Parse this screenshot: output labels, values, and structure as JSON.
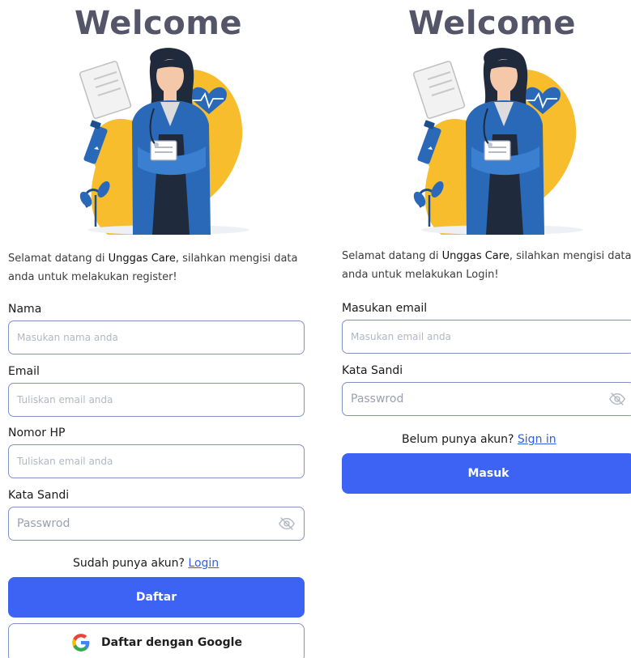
{
  "register": {
    "title": "Welcome",
    "intro_prefix": "Selamat datang di ",
    "brand": "Unggas Care",
    "intro_suffix": ", silahkan mengisi data anda untuk melakukan register!",
    "fields": [
      {
        "label": "Nama",
        "placeholder": "Masukan nama anda",
        "value": ""
      },
      {
        "label": "Email",
        "placeholder": "Tuliskan email anda",
        "value": ""
      },
      {
        "label": "Nomor HP",
        "placeholder": "Tuliskan email anda",
        "value": ""
      },
      {
        "label": "Kata Sandi",
        "placeholder": "Passwrod",
        "value": ""
      }
    ],
    "switch_prompt": "Sudah punya akun? ",
    "switch_link": "Login",
    "primary_label": "Daftar",
    "google_label": "Daftar dengan Google"
  },
  "login": {
    "title": "Welcome",
    "intro_prefix": "Selamat datang di ",
    "brand": "Unggas Care",
    "intro_suffix": ", silahkan mengisi data anda untuk melakukan Login!",
    "fields": [
      {
        "label": "Masukan email",
        "placeholder": "Masukan email anda",
        "value": ""
      },
      {
        "label": "Kata Sandi",
        "placeholder": "Passwrod",
        "value": ""
      }
    ],
    "switch_prompt": "Belum punya akun? ",
    "switch_link": "Sign in",
    "primary_label": "Masuk"
  },
  "icons": {
    "password_toggle": "eye-slash-icon",
    "google": "google-logo-icon",
    "illustration": "doctor-illustration"
  },
  "colors": {
    "title": "#55556a",
    "primary": "#3d63f5",
    "link": "#2f5ee8",
    "field_border": "#7f92c7",
    "illustration_yellow": "#f7bd2d",
    "illustration_blue": "#2a69b7"
  }
}
